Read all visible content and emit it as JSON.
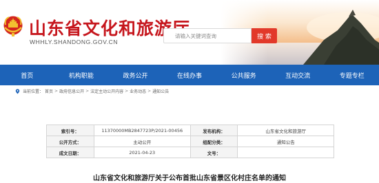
{
  "header": {
    "site_title": "山东省文化和旅游厅",
    "site_domain": "WHHLY.SHANDONG.GOV.CN",
    "search_placeholder": "请输入关键词查询",
    "search_label": "搜 索"
  },
  "nav": {
    "items": [
      "首页",
      "机构职能",
      "政务公开",
      "在线办事",
      "公共服务",
      "互动交流",
      "专题专栏"
    ]
  },
  "breadcrumb": {
    "prefix": "当前位置：",
    "items": [
      "首页",
      "政府信息公开",
      "法定主动公开内容",
      "业务动态",
      "通知公告"
    ],
    "separator": ">"
  },
  "info": {
    "rows": [
      {
        "label1": "索引号：",
        "value1": "11370000MB2847723P/2021-00456",
        "label2": "发布机构：",
        "value2": "山东省文化和旅游厅"
      },
      {
        "label1": "公开方式：",
        "value1": "主动公开",
        "label2": "组配分类：",
        "value2": "通知公告"
      },
      {
        "label1": "成文日期：",
        "value1": "2021-04-23",
        "label2": "文号：",
        "value2": ""
      }
    ]
  },
  "document": {
    "title": "山东省文化和旅游厅关于公布首批山东省景区化村庄名单的通知"
  },
  "colors": {
    "brand_red": "#c6161d",
    "nav_blue": "#1d63b8",
    "search_button": "#e2392a"
  }
}
